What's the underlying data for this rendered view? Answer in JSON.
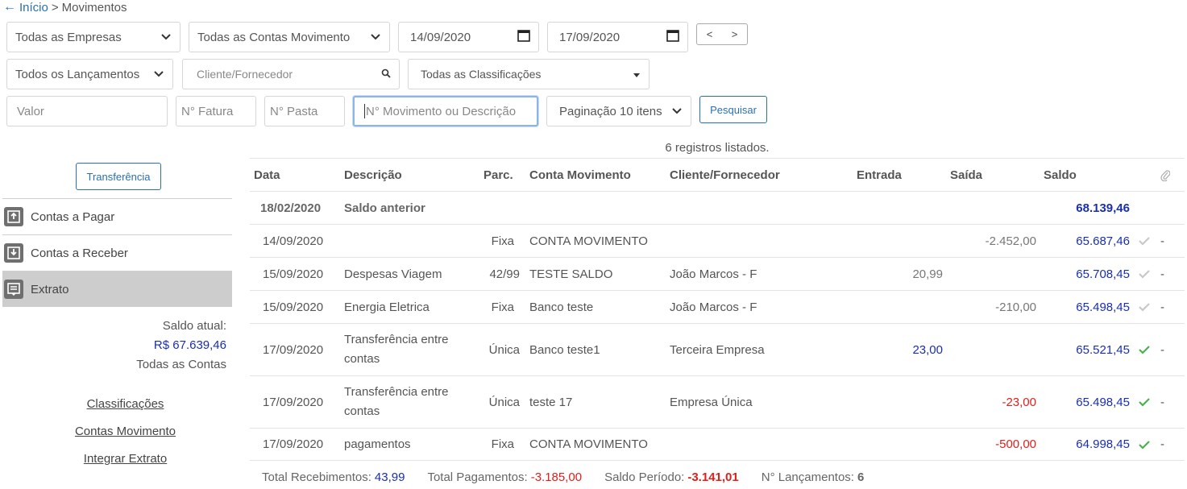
{
  "breadcrumb": {
    "home": "Início",
    "separator": ">",
    "current": "Movimentos"
  },
  "filters": {
    "empresa": "Todas as Empresas",
    "conta": "Todas as Contas Movimento",
    "date_from": "14/09/2020",
    "date_to": "17/09/2020",
    "prev": "<",
    "next": ">",
    "lancamentos": "Todos os Lançamentos",
    "cliente_placeholder": "Cliente/Fornecedor",
    "classificacoes": "Todas as Classificações",
    "valor_placeholder": "Valor",
    "fatura_placeholder": "N° Fatura",
    "pasta_placeholder": "N° Pasta",
    "movimento_placeholder": "N° Movimento ou Descrição",
    "paginacao": "Paginação 10 itens",
    "pesquisar": "Pesquisar"
  },
  "records_info": "6 registros listados.",
  "sidebar": {
    "transfer_button": "Transferência",
    "menu": [
      {
        "label": "Contas a Pagar",
        "icon": "upload-tray-icon"
      },
      {
        "label": "Contas a Receber",
        "icon": "download-tray-icon"
      },
      {
        "label": "Extrato",
        "icon": "statement-icon"
      }
    ],
    "saldo_label": "Saldo atual:",
    "saldo_value": "R$ 67.639,46",
    "saldo_scope": "Todas as Contas",
    "links": [
      "Classificações",
      "Contas Movimento",
      "Integrar Extrato"
    ]
  },
  "table": {
    "headers": {
      "data": "Data",
      "descricao": "Descrição",
      "parc": "Parc.",
      "conta": "Conta Movimento",
      "cliente": "Cliente/Fornecedor",
      "entrada": "Entrada",
      "saida": "Saída",
      "saldo": "Saldo"
    },
    "previous": {
      "data": "18/02/2020",
      "descricao": "Saldo anterior",
      "saldo": "68.139,46"
    },
    "rows": [
      {
        "data": "14/09/2020",
        "descricao": "",
        "parc": "Fixa",
        "conta": "CONTA MOVIMENTO",
        "cliente": "",
        "entrada": "",
        "saida": "-2.452,00",
        "saldo": "65.687,46",
        "conciliado": false,
        "anexo": "-"
      },
      {
        "data": "15/09/2020",
        "descricao": "Despesas Viagem",
        "parc": "42/99",
        "conta": "TESTE SALDO",
        "cliente": "João Marcos - F",
        "entrada": "20,99",
        "saida": "",
        "saldo": "65.708,45",
        "conciliado": false,
        "anexo": "-"
      },
      {
        "data": "15/09/2020",
        "descricao": "Energia Eletrica",
        "parc": "Fixa",
        "conta": "Banco teste",
        "cliente": "João Marcos - F",
        "entrada": "",
        "saida": "-210,00",
        "saldo": "65.498,45",
        "conciliado": false,
        "anexo": "-"
      },
      {
        "data": "17/09/2020",
        "descricao_l1": "Transferência entre",
        "descricao_l2": "contas",
        "parc": "Única",
        "conta": "Banco teste1",
        "cliente": "Terceira Empresa",
        "entrada": "23,00",
        "saida": "",
        "saldo": "65.521,45",
        "conciliado": true,
        "anexo": "-"
      },
      {
        "data": "17/09/2020",
        "descricao_l1": "Transferência entre",
        "descricao_l2": "contas",
        "parc": "Única",
        "conta": "teste 17",
        "cliente": "Empresa Única",
        "entrada": "",
        "saida": "-23,00",
        "saldo": "65.498,45",
        "conciliado": true,
        "anexo": "-"
      },
      {
        "data": "17/09/2020",
        "descricao": "pagamentos",
        "parc": "Fixa",
        "conta": "CONTA MOVIMENTO",
        "cliente": "",
        "entrada": "",
        "saida": "-500,00",
        "saldo": "64.998,45",
        "conciliado": true,
        "anexo": "-"
      }
    ]
  },
  "totals": {
    "recebimentos_label": "Total Recebimentos:",
    "recebimentos": "43,99",
    "pagamentos_label": "Total Pagamentos:",
    "pagamentos": "-3.185,00",
    "saldo_label": "Saldo Período:",
    "saldo": "-3.141,01",
    "lancamentos_label": "N° Lançamentos:",
    "lancamentos": "6"
  },
  "colors": {
    "link_blue": "#2a6fb0",
    "value_blue": "#1a2fae",
    "negative_red": "#e0201c",
    "check_green": "#4caf50",
    "check_grey": "#c8c8c8"
  }
}
